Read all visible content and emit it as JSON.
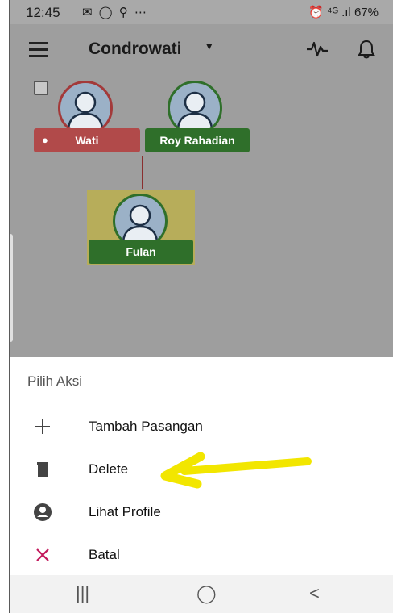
{
  "status_bar": {
    "time": "12:45",
    "notification_icons": "✉ ◯ ⚲ ⋯",
    "right_text": "⏰ ⁴ᴳ .ıl 67%"
  },
  "app_bar": {
    "title": "Condrowati",
    "caret": "▾"
  },
  "tree": {
    "person_1": {
      "name": "Wati",
      "color": "#b14a4a"
    },
    "person_2": {
      "name": "Roy Rahadian",
      "color": "#2f6f2a"
    },
    "child": {
      "name": "Fulan",
      "color": "#2f6f2a"
    }
  },
  "sheet": {
    "heading": "Pilih Aksi",
    "actions": [
      {
        "label": "Tambah Pasangan",
        "icon": "plus-icon"
      },
      {
        "label": "Delete",
        "icon": "trash-icon"
      },
      {
        "label": "Lihat Profile",
        "icon": "account-circle-icon"
      },
      {
        "label": "Batal",
        "icon": "close-icon"
      }
    ]
  },
  "nav_bar": {
    "recents": "|||",
    "home": "◯",
    "back": "<"
  },
  "colors": {
    "overlay_gray": "#9e9e9e",
    "highlight_yellow": "#f2e600",
    "cancel_red": "#c2185b"
  }
}
